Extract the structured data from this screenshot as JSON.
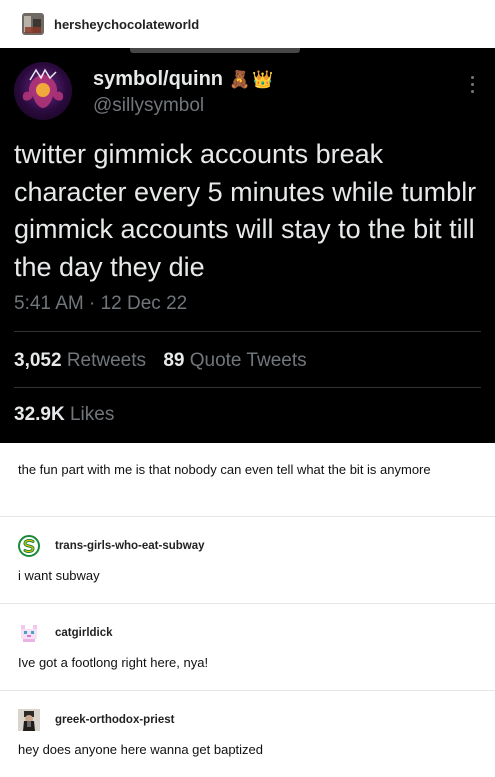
{
  "post": {
    "blog_name": "hersheychocolateworld",
    "avatar_icon": "blog-avatar"
  },
  "tweet": {
    "display_name": "symbol/quinn",
    "emojis": [
      "🧸",
      "👑"
    ],
    "handle": "@sillysymbol",
    "text": "twitter gimmick accounts break character every 5 minutes while tumblr gimmick accounts will stay to the bit till the day they die",
    "timestamp": "5:41 AM · 12 Dec 22",
    "retweets_count": "3,052",
    "retweets_label": "Retweets",
    "quotes_count": "89",
    "quotes_label": "Quote Tweets",
    "likes_count": "32.9K",
    "likes_label": "Likes",
    "colors": {
      "background": "#000000",
      "text": "#e7e9ea",
      "muted": "#71767b"
    }
  },
  "caption": "the fun part with me is that nobody can even tell what the bit is anymore",
  "replies": [
    {
      "name": "trans-girls-who-eat-subway",
      "text": "i want subway",
      "icon": "subway-logo-icon",
      "color": "#1a8a3a"
    },
    {
      "name": "catgirldick",
      "text": "Ive got a footlong right here, nya!",
      "icon": "pixel-cat-icon",
      "color": "#d27ad8"
    },
    {
      "name": "greek-orthodox-priest",
      "text": "hey does anyone here wanna get baptized",
      "icon": "priest-avatar-icon",
      "color": "#444444"
    }
  ]
}
